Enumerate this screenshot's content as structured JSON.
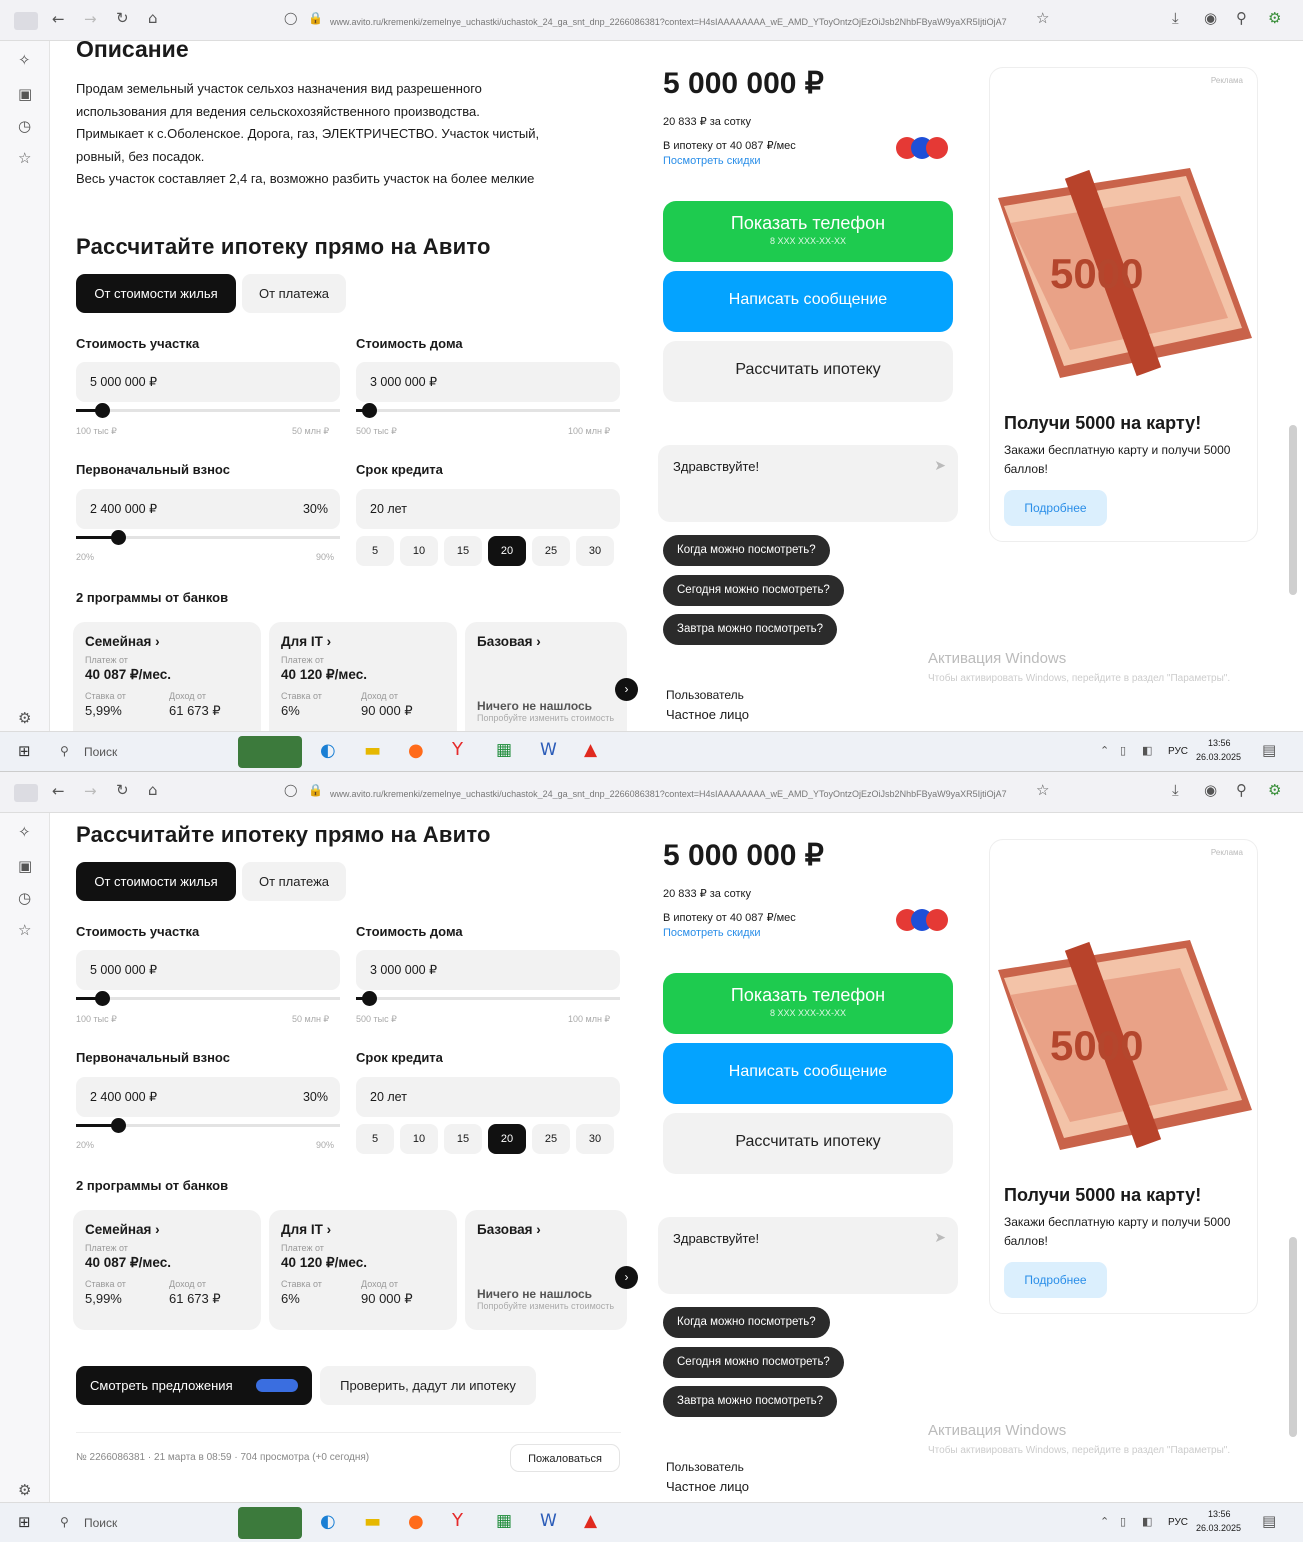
{
  "browser": {
    "url": "www.avito.ru/kremenki/zemelnye_uchastki/uchastok_24_ga_snt_dnp_2266086381?context=H4sIAAAAAAAA_wE_AMD_YToyOntzOjEzOiJsb2NhbFByaW9yaXR5IjtiOjA7"
  },
  "taskbar": {
    "search": "Поиск",
    "lang": "РУС",
    "time": "13:56",
    "date": "26.03.2025"
  },
  "description": {
    "heading": "Описание",
    "lines": [
      "Продам земельный участок сельхоз назначения вид разрешенного",
      "использования для ведения сельскохозяйственного производства.",
      "Примыкает к с.Оболенское. Дорога, газ, ЭЛЕКТРИЧЕСТВО. Участок чистый,",
      "ровный, без посадок.",
      "Весь участок составляет 2,4 га, возможно разбить участок на более мелкие"
    ]
  },
  "mortgage": {
    "title": "Рассчитайте ипотеку прямо на Авито",
    "tabs": [
      "От стоимости жилья",
      "От платежа"
    ],
    "plot_cost": {
      "label": "Стоимость участка",
      "value": "5 000 000 ₽",
      "min": "100 тыс ₽",
      "max": "50 млн ₽",
      "fill": 0.1
    },
    "house_cost": {
      "label": "Стоимость дома",
      "value": "3 000 000 ₽",
      "min": "500 тыс ₽",
      "max": "100 млн ₽",
      "fill": 0.05
    },
    "down_payment": {
      "label": "Первоначальный взнос",
      "value": "2 400 000 ₽",
      "percent": "30%",
      "min": "20%",
      "max": "90%",
      "fill": 0.16
    },
    "term": {
      "label": "Срок кредита",
      "value": "20 лет",
      "options": [
        "5",
        "10",
        "15",
        "20",
        "25",
        "30"
      ],
      "selected": "20"
    },
    "programs_title": "2 программы от банков",
    "programs": [
      {
        "name": "Семейная ›",
        "pay_label": "Платеж от",
        "pay": "40 087 ₽/мес.",
        "rate_label": "Ставка от",
        "rate": "5,99%",
        "income_label": "Доход от",
        "income": "61 673 ₽"
      },
      {
        "name": "Для IT ›",
        "pay_label": "Платеж от",
        "pay": "40 120 ₽/мес.",
        "rate_label": "Ставка от",
        "rate": "6%",
        "income_label": "Доход от",
        "income": "90 000 ₽"
      },
      {
        "name": "Базовая ›",
        "empty": "Ничего не нашлось",
        "empty_hint": "Попробуйте изменить стоимость"
      }
    ],
    "offers_button": "Смотреть предложения",
    "check_button": "Проверить, дадут ли ипотеку"
  },
  "footer": {
    "meta": "№ 2266086381 · 21 марта в 08:59 · 704 просмотра (+0 сегодня)",
    "complain": "Пожаловаться"
  },
  "listing": {
    "price": "5 000 000 ₽",
    "per_sotka": "20 833 ₽ за сотку",
    "mortgage_from": "В ипотеку от 40 087 ₽/мес",
    "discounts_link": "Посмотреть скидки",
    "show_phone": "Показать телефон",
    "phone_mask": "8 XXX XXX-XX-XX",
    "write_message": "Написать сообщение",
    "calc_mortgage": "Рассчитать ипотеку",
    "chat_placeholder": "Здравствуйте!",
    "quick_questions": [
      "Когда можно посмотреть?",
      "Сегодня можно посмотреть?",
      "Завтра можно посмотреть?"
    ],
    "seller_role": "Пользователь",
    "seller_name": "Частное лицо"
  },
  "ad": {
    "tag": "Реклама",
    "title": "Получи 5000 на карту!",
    "text": "Закажи бесплатную карту и получи 5000 баллов!",
    "button": "Подробнее",
    "banknote_text": "5000"
  },
  "windows": {
    "activation": "Активация Windows",
    "hint": "Чтобы активировать Windows, перейдите в раздел \"Параметры\"."
  },
  "colors": {
    "green": "#1ecb4f",
    "blue": "#04a3ff",
    "dark": "#111111",
    "link": "#2a8ee8"
  }
}
